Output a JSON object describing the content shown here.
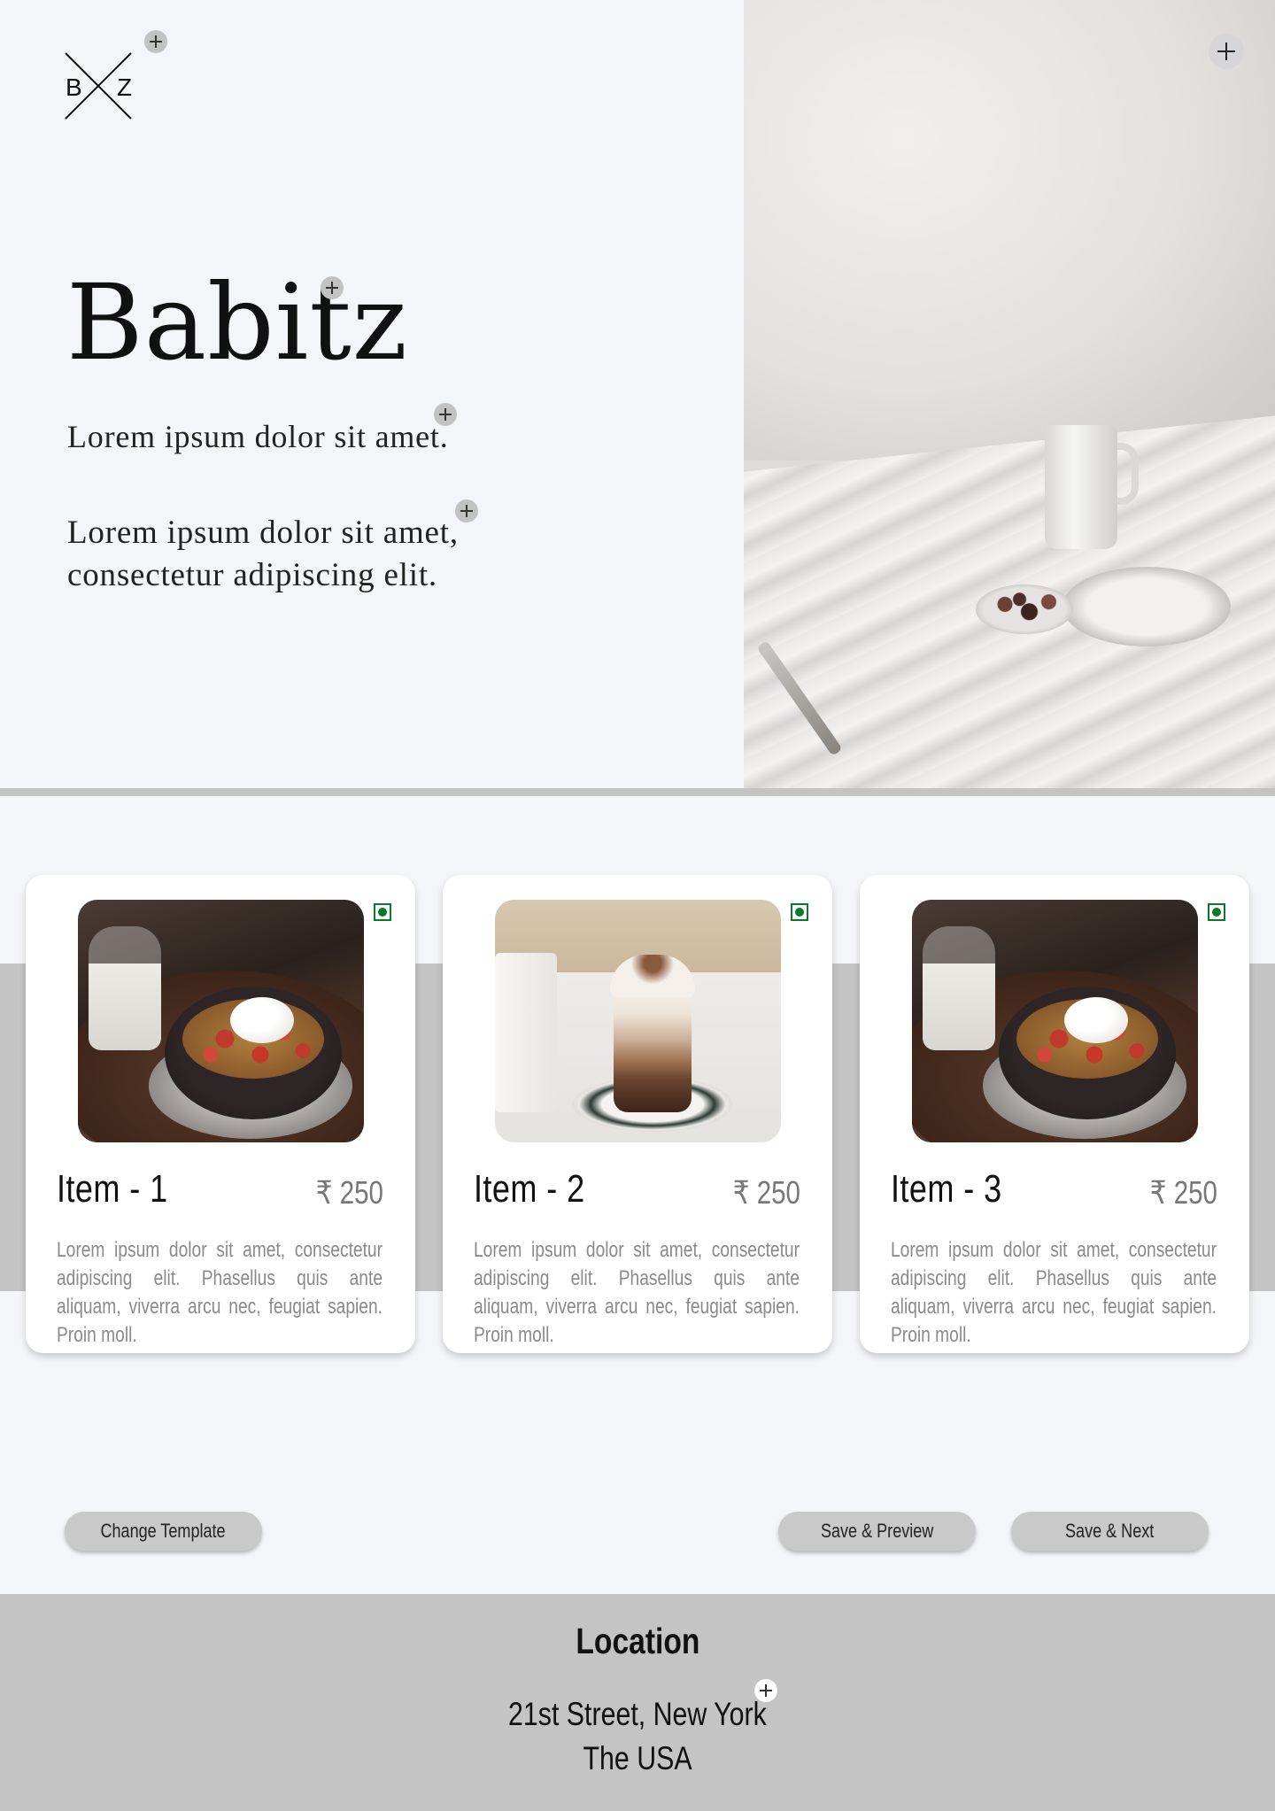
{
  "brand": {
    "logo_letters": "B Z",
    "title": "Babitz",
    "tagline": "Lorem ipsum dolor sit amet.",
    "description": "Lorem ipsum dolor sit amet, consectetur adipiscing elit."
  },
  "menu": {
    "items": [
      {
        "name": "Item - 1",
        "price": "₹ 250",
        "description": "Lorem ipsum dolor sit amet, consectetur adipiscing elit. Phasellus quis ante aliquam, viverra arcu nec, feugiat sapien. Proin moll.",
        "image": "granola-bowl-photo",
        "veg": true
      },
      {
        "name": "Item - 2",
        "price": "₹ 250",
        "description": "Lorem ipsum dolor sit amet, consectetur adipiscing elit. Phasellus quis ante aliquam, viverra arcu nec, feugiat sapien. Proin moll.",
        "image": "layered-coffee-photo",
        "veg": true
      },
      {
        "name": "Item - 3",
        "price": "₹ 250",
        "description": "Lorem ipsum dolor sit amet, consectetur adipiscing elit. Phasellus quis ante aliquam, viverra arcu nec, feugiat sapien. Proin moll.",
        "image": "granola-bowl-photo",
        "veg": true
      }
    ]
  },
  "actions": {
    "change_template": "Change Template",
    "save_preview": "Save & Preview",
    "save_next": "Save & Next"
  },
  "footer": {
    "title": "Location",
    "address_line1": "21st Street, New York",
    "address_line2": "The USA"
  },
  "icons": {
    "add": "plus-icon",
    "veg": "veg-indicator-icon"
  },
  "colors": {
    "background": "#f4f5f8",
    "band": "#c4c4c4",
    "veg_green": "#0a7a2a",
    "button": "#c9c9c9"
  }
}
